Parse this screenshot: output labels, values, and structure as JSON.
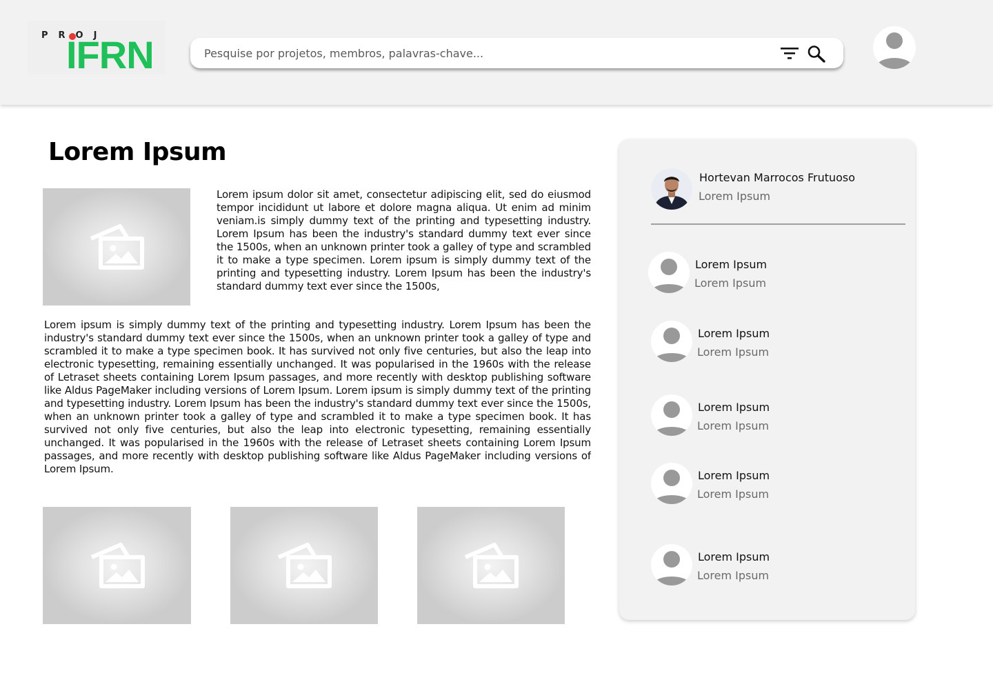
{
  "logo": {
    "proj_text": "PROJ",
    "brand_text": "IFRN"
  },
  "search": {
    "placeholder": "Pesquise por projetos, membros, palavras-chave..."
  },
  "icons": {
    "filter": "filter-icon",
    "search": "search-icon",
    "user": "user-avatar-icon",
    "image": "image-placeholder-icon"
  },
  "project": {
    "title": "Lorem Ipsum",
    "paragraph_1": "Lorem ipsum dolor sit amet, consectetur adipiscing elit, sed do eiusmod tempor incididunt ut labore et dolore magna aliqua. Ut enim ad minim veniam.is simply dummy text of the printing and typesetting industry. Lorem Ipsum has been the industry's standard dummy text ever since the 1500s, when an unknown printer took a galley of type and scrambled it to make a type specimen. Lorem ipsum is simply dummy text of the printing and typesetting industry. Lorem Ipsum has been the industry's standard dummy text ever since the 1500s,",
    "paragraph_2": "Lorem ipsum is simply dummy text of the printing and typesetting industry. Lorem Ipsum has been the industry's standard dummy text ever since the 1500s, when an unknown printer took a galley of type and scrambled it to make a type specimen book. It has survived not only five centuries, but also the leap into electronic typesetting, remaining essentially unchanged. It was popularised in the 1960s with the release of Letraset sheets containing Lorem Ipsum passages, and more recently with desktop publishing software like Aldus PageMaker including versions of Lorem Ipsum. Lorem ipsum is simply dummy text of the printing and typesetting industry. Lorem Ipsum has been the industry's standard dummy text ever since the 1500s, when an unknown printer took a galley of type and scrambled it to make a type specimen book. It has survived not only five centuries, but also the leap into electronic typesetting, remaining essentially unchanged. It was popularised in the 1960s with the release of Letraset sheets containing Lorem Ipsum passages, and more recently with desktop publishing software like Aldus PageMaker including versions of Lorem Ipsum."
  },
  "sidebar": {
    "owner": {
      "name": "Hortevan Marrocos Frutuoso",
      "role": "Lorem Ipsum"
    },
    "members": [
      {
        "name": "Lorem Ipsum",
        "role": "Lorem Ipsum"
      },
      {
        "name": "Lorem Ipsum",
        "role": "Lorem Ipsum"
      },
      {
        "name": "Lorem Ipsum",
        "role": "Lorem Ipsum"
      },
      {
        "name": "Lorem Ipsum",
        "role": "Lorem Ipsum"
      },
      {
        "name": "Lorem Ipsum",
        "role": "Lorem Ipsum"
      }
    ]
  },
  "colors": {
    "brand_green": "#1fbf5a",
    "brand_red": "#e53935",
    "header_bg": "#f2f2f2",
    "sidebar_bg": "#f2f2f2"
  }
}
